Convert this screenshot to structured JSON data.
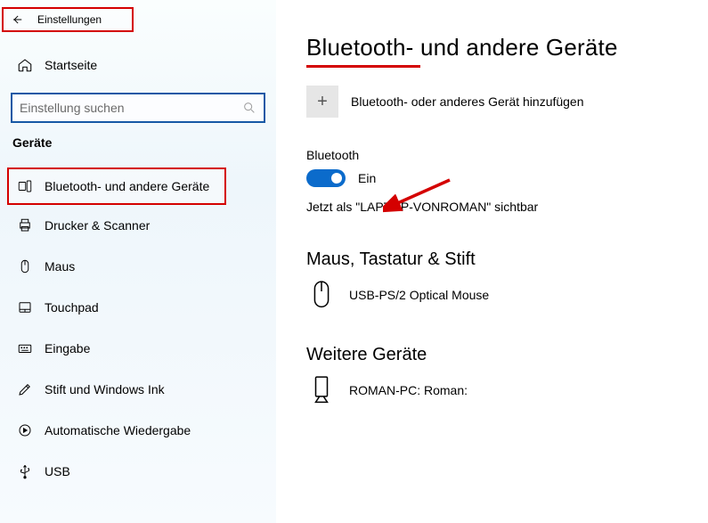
{
  "header": {
    "title": "Einstellungen"
  },
  "home": {
    "label": "Startseite"
  },
  "search": {
    "placeholder": "Einstellung suchen"
  },
  "section": {
    "label": "Geräte"
  },
  "nav": {
    "bluetooth": "Bluetooth- und andere Geräte",
    "printers": "Drucker & Scanner",
    "mouse": "Maus",
    "touchpad": "Touchpad",
    "typing": "Eingabe",
    "pen": "Stift und Windows Ink",
    "autoplay": "Automatische Wiedergabe",
    "usb": "USB"
  },
  "page": {
    "title": "Bluetooth- und andere Geräte",
    "add_device": "Bluetooth- oder anderes Gerät hinzufügen",
    "bt_label": "Bluetooth",
    "bt_state": "Ein",
    "visible_as": "Jetzt als \"LAPTOP-VONROMAN\" sichtbar",
    "group_mouse": "Maus, Tastatur & Stift",
    "device_mouse": "USB-PS/2 Optical Mouse",
    "group_other": "Weitere Geräte",
    "device_other": "ROMAN-PC: Roman:"
  }
}
